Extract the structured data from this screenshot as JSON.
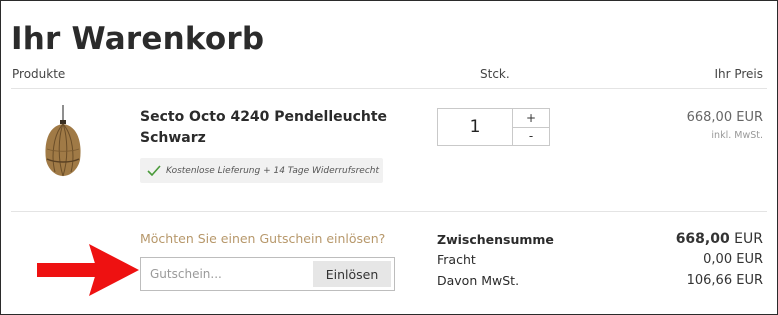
{
  "cart": {
    "title": "Ihr Warenkorb",
    "columns": {
      "products": "Produkte",
      "quantity": "Stck.",
      "price": "Ihr Preis"
    }
  },
  "item": {
    "name": "Secto Octo 4240 Pendelleuchte Schwarz",
    "badge": "Kostenlose Lieferung + 14 Tage Widerrufsrecht",
    "quantity": "1",
    "increment_label": "+",
    "decrement_label": "-",
    "price": "668,00 EUR",
    "vat_note": "inkl. MwSt.",
    "image_icon": "pendant-lamp"
  },
  "coupon": {
    "question": "Möchten Sie einen Gutschein einlösen?",
    "placeholder": "Gutschein...",
    "value": "",
    "button_label": "Einlösen"
  },
  "summary": {
    "subtotal_label": "Zwischensumme",
    "subtotal_amount": "668,00",
    "subtotal_currency": "EUR",
    "shipping_label": "Fracht",
    "shipping_value": "0,00 EUR",
    "vat_label": "Davon MwSt.",
    "vat_value": "106,66 EUR"
  },
  "annotation": {
    "icon": "arrow-right-icon",
    "color": "#ee1111"
  },
  "colors": {
    "accent": "#b7986b",
    "check": "#4a9a3a",
    "text": "#2b2b2b"
  }
}
